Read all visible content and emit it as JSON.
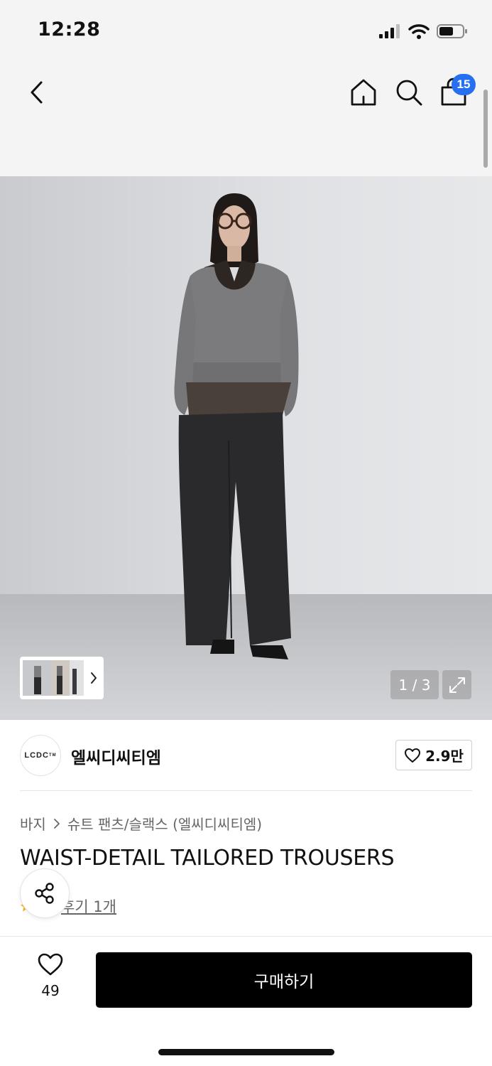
{
  "status_bar": {
    "time": "12:28"
  },
  "nav": {
    "bag_badge": "15"
  },
  "gallery": {
    "counter": "1 / 3"
  },
  "brand": {
    "logo_text": "LCDC",
    "logo_mark": "TM",
    "name": "엘씨디씨티엠",
    "like_count": "2.9만"
  },
  "product": {
    "breadcrumb": [
      "바지",
      "슈트 팬츠/슬랙스 (엘씨디씨티엠)"
    ],
    "title": "WAIST-DETAIL TAILORED TROUSERS",
    "review_link": "후기 1개"
  },
  "bottom_bar": {
    "wish_count": "49",
    "buy_label": "구매하기"
  },
  "colors": {
    "badge": "#2670f0",
    "buy_button": "#000000",
    "star": "#f5b400"
  },
  "icons": [
    "back-icon",
    "home-icon",
    "search-icon",
    "bag-icon",
    "expand-icon",
    "heart-icon",
    "share-icon",
    "chevron-right-icon",
    "star-icon"
  ]
}
